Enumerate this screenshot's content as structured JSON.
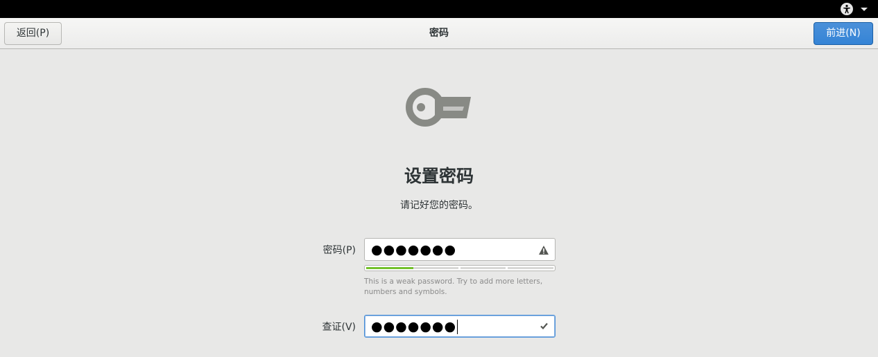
{
  "header": {
    "back_label": "返回(P)",
    "title": "密码",
    "next_label": "前进(N)"
  },
  "page": {
    "heading": "设置密码",
    "subtitle": "请记好您的密码。"
  },
  "password": {
    "label": "密码(P)",
    "masked_value": "●●●●●●●",
    "strength_level": 0.25,
    "strength_color": "#73c12a",
    "hint": "This is a weak password. Try to add more letters, numbers and symbols."
  },
  "verify": {
    "label": "查证(V)",
    "masked_value": "●●●●●●●"
  },
  "icons": {
    "top_bar": [
      "accessibility-icon",
      "dropdown-arrow-icon"
    ],
    "page": "key-icon",
    "password": "warning-icon",
    "verify": "checkmark-icon"
  },
  "colors": {
    "accent": "#3584d6",
    "background": "#e8e8e7"
  }
}
